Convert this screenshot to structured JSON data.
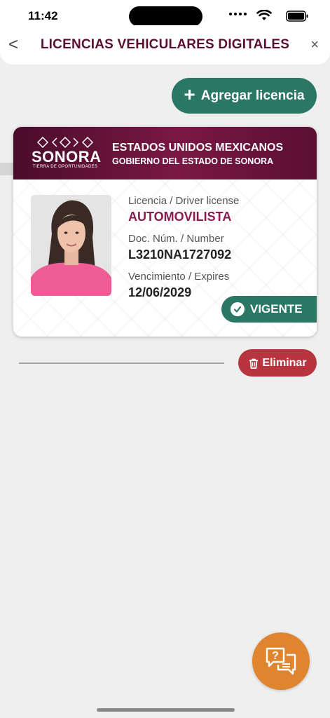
{
  "status_bar": {
    "time": "11:42"
  },
  "header": {
    "back_glyph": "<",
    "title": "LICENCIAS VEHICULARES DIGITALES",
    "close_glyph": "×"
  },
  "add_button": {
    "label": "Agregar licencia",
    "icon": "plus-icon"
  },
  "license_card": {
    "logo": {
      "name": "SONORA",
      "tagline": "TIERRA DE OPORTUNIDADES"
    },
    "country": "ESTADOS UNIDOS MEXICANOS",
    "government": "GOBIERNO DEL ESTADO DE SONORA",
    "license_label": "Licencia / Driver license",
    "license_type": "AUTOMOVILISTA",
    "doc_label": "Doc. Núm. / Number",
    "doc_number": "L3210NA1727092",
    "expires_label": "Vencimiento / Expires",
    "expires_date": "12/06/2029",
    "status": "VIGENTE"
  },
  "delete_button": {
    "label": "Eliminar",
    "icon": "trash-icon"
  },
  "help_fab": {
    "icon": "help-chat-icon"
  },
  "colors": {
    "brand_maroon": "#7a1845",
    "green": "#2a7764",
    "delete_red": "#b8343f",
    "fab_orange": "#e0852f"
  }
}
